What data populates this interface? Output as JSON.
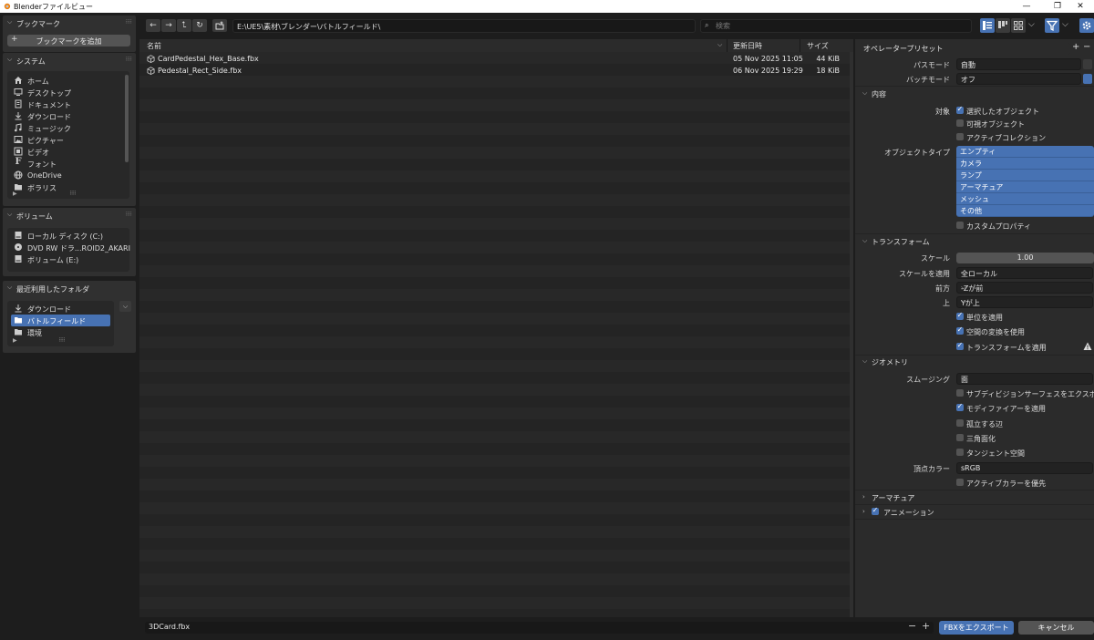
{
  "window": {
    "title": "Blenderファイルビュー",
    "minimize": "—",
    "maximize": "❐",
    "close": "✕"
  },
  "sidebar": {
    "bookmarks": {
      "title": "ブックマーク",
      "add_label": "ブックマークを追加"
    },
    "system": {
      "title": "システム",
      "items": [
        {
          "label": "ホーム",
          "icon": "home-icon"
        },
        {
          "label": "デスクトップ",
          "icon": "desktop-icon"
        },
        {
          "label": "ドキュメント",
          "icon": "documents-icon"
        },
        {
          "label": "ダウンロード",
          "icon": "download-icon"
        },
        {
          "label": "ミュージック",
          "icon": "music-icon"
        },
        {
          "label": "ピクチャー",
          "icon": "pictures-icon"
        },
        {
          "label": "ビデオ",
          "icon": "video-icon"
        },
        {
          "label": "フォント",
          "icon": "font-icon"
        },
        {
          "label": "OneDrive",
          "icon": "globe-icon"
        },
        {
          "label": "ボラリス",
          "icon": "folder-icon"
        }
      ]
    },
    "volumes": {
      "title": "ボリューム",
      "items": [
        {
          "label": "ローカル ディスク (C:)",
          "icon": "disk-icon"
        },
        {
          "label": "DVD RW ドラ...ROID2_AKARI",
          "icon": "dvd-icon"
        },
        {
          "label": "ボリューム (E:)",
          "icon": "disk-icon"
        }
      ]
    },
    "recent": {
      "title": "最近利用したフォルダ",
      "items": [
        {
          "label": "ダウンロード",
          "icon": "download-icon"
        },
        {
          "label": "バトルフィールド",
          "icon": "folder-icon",
          "selected": true
        },
        {
          "label": "環境",
          "icon": "folder-icon"
        }
      ]
    }
  },
  "toolbar": {
    "path": "E:\\UE5\\素材\\ブレンダー\\バトルフィールド\\",
    "search_placeholder": "検索"
  },
  "filelist": {
    "columns": {
      "name": "名前",
      "date": "更新日時",
      "size": "サイズ"
    },
    "files": [
      {
        "name": "CardPedestal_Hex_Base.fbx",
        "date": "05 Nov 2025 11:05",
        "size": "44 KiB"
      },
      {
        "name": "Pedestal_Rect_Side.fbx",
        "date": "06 Nov 2025 19:29",
        "size": "18 KiB"
      }
    ]
  },
  "props": {
    "operator_preset": "オペレータープリセット",
    "path_mode": {
      "label": "パスモード",
      "value": "自動"
    },
    "batch_mode": {
      "label": "バッチモード",
      "value": "オフ"
    },
    "include": {
      "title": "内容",
      "target_label": "対象",
      "selected_objects": "選択したオブジェクト",
      "visible_objects": "可視オブジェクト",
      "active_collection": "アクティブコレクション",
      "object_types_label": "オブジェクトタイプ",
      "object_types": [
        "エンプティ",
        "カメラ",
        "ランプ",
        "アーマチュア",
        "メッシュ",
        "その他"
      ],
      "custom_props": "カスタムプロパティ"
    },
    "transform": {
      "title": "トランスフォーム",
      "scale_label": "スケール",
      "scale_value": "1.00",
      "apply_scale_label": "スケールを適用",
      "apply_scale_value": "全ローカル",
      "forward_label": "前方",
      "forward_value": "-Zが前",
      "up_label": "上",
      "up_value": "Yが上",
      "apply_unit": "単位を適用",
      "use_space_transform": "空間の変換を使用",
      "apply_transform": "トランスフォームを適用"
    },
    "geometry": {
      "title": "ジオメトリ",
      "smoothing_label": "スムージング",
      "smoothing_value": "面",
      "export_subdiv": "サブディビジョンサーフェスをエクスポ...",
      "apply_modifiers": "モディファイアーを適用",
      "loose_edges": "孤立する辺",
      "triangulate": "三角面化",
      "tangent_space": "タンジェント空間",
      "vertex_color_label": "頂点カラー",
      "vertex_color_value": "sRGB",
      "prioritize_active_color": "アクティブカラーを優先"
    },
    "armature": {
      "title": "アーマチュア"
    },
    "animation": {
      "title": "アニメーション"
    }
  },
  "bottom": {
    "filename": "3DCard.fbx",
    "minus": "−",
    "plus": "+",
    "export_label": "FBXをエクスポート",
    "cancel_label": "キャンセル"
  },
  "colors": {
    "accent": "#4772b3",
    "panel": "#303030",
    "background": "#1d1d1d"
  }
}
